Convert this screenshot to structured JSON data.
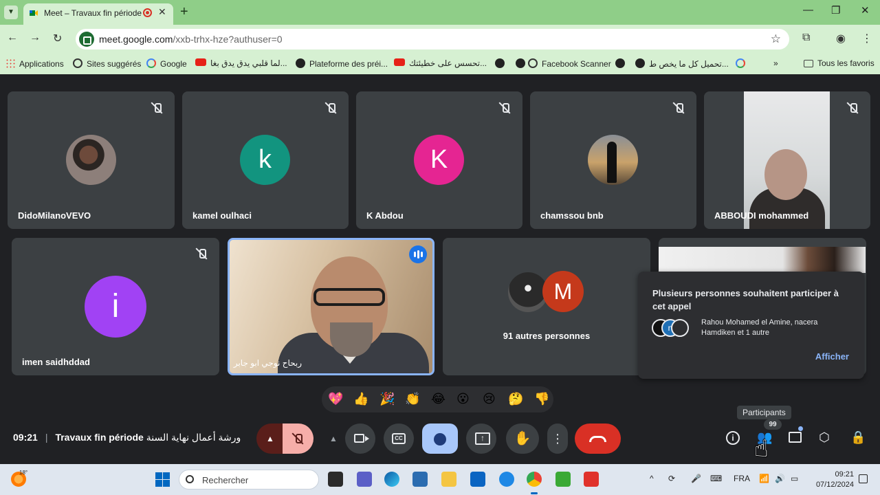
{
  "browser": {
    "tab_title": "Meet – Travaux fin période",
    "url_host": "meet.google.com",
    "url_path": "/xxb-trhx-hze?authuser=0",
    "bookmarks": [
      {
        "label": "Applications",
        "icon": "apps-grid-icon"
      },
      {
        "label": "Sites suggérés",
        "icon": "search-icon"
      },
      {
        "label": "Google",
        "icon": "google-icon"
      },
      {
        "label": "لما قلبي يدق يدق بغا...",
        "icon": "youtube-icon"
      },
      {
        "label": "Plateforme des préi...",
        "icon": "globe-icon"
      },
      {
        "label": "تحسس على خطيئتك...",
        "icon": "youtube-icon"
      },
      {
        "label": "",
        "icon": "globe-icon"
      },
      {
        "label": "Facebook Scanner",
        "icon": "search-icon"
      },
      {
        "label": "",
        "icon": "globe-icon"
      },
      {
        "label": "تحميل كل ما يخص ط...",
        "icon": "globe-icon"
      },
      {
        "label": "",
        "icon": "google-icon"
      }
    ],
    "all_bookmarks_label": "Tous les favoris"
  },
  "participants_row1": [
    {
      "name": "DidoMilanoVEVO",
      "avatar_type": "photo"
    },
    {
      "name": "kamel oulhaci",
      "avatar_letter": "k",
      "color": "#12947f"
    },
    {
      "name": "K Abdou",
      "avatar_letter": "K",
      "color": "#e52592"
    },
    {
      "name": "chamssou bnb",
      "avatar_type": "photo"
    },
    {
      "name": "ABBOUDI mohammed",
      "avatar_type": "video"
    }
  ],
  "participants_row2": [
    {
      "name": "imen saidhddad",
      "avatar_letter": "i",
      "color": "#a142f4"
    },
    {
      "name": "ربحاح نوجي ابو جابر",
      "avatar_type": "video",
      "speaking": true
    }
  ],
  "others": {
    "avatar_letter": "M",
    "label": "91 autres personnes"
  },
  "join_popup": {
    "title": "Plusieurs personnes souhaitent participer à cet appel",
    "names": "Rahou Mohamed el Amine, nacera Hamdiken et 1 autre",
    "avatar_letter": "n",
    "button": "Afficher"
  },
  "reactions": [
    "💖",
    "👍",
    "🎉",
    "👏",
    "😂",
    "😮",
    "😢",
    "🤔",
    "👎"
  ],
  "meeting": {
    "time": "09:21",
    "title": "Travaux fin période",
    "title_arabic": "ورشة أعمال نهاية السنة"
  },
  "tooltip": "Participants",
  "participant_count": "99",
  "taskbar": {
    "temperature": "18°",
    "search_placeholder": "Rechercher",
    "language": "FRA",
    "clock_time": "09:21",
    "clock_date": "07/12/2024"
  }
}
